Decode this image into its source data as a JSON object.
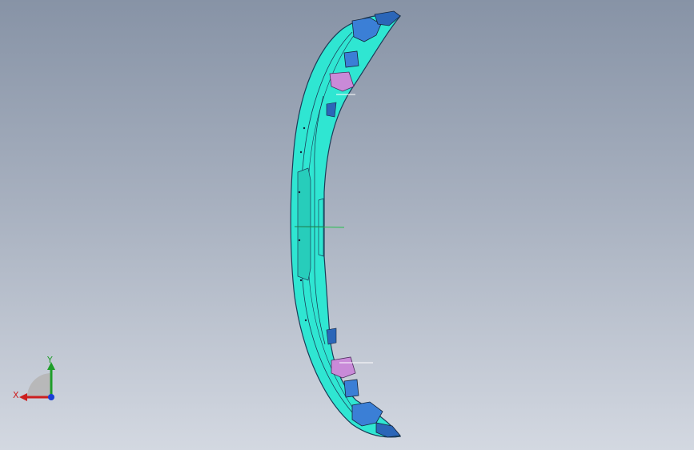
{
  "viewport": {
    "background_top": "#8793a6",
    "background_bottom": "#d3d8e1"
  },
  "model": {
    "icon": "bumper-part-icon",
    "body_color": "#2fe6d2",
    "edge_color": "#1b3b57",
    "bracket_color": "#3b7fd6",
    "clip_color": "#c98ad8",
    "origin_axis_color": "#22c04a"
  },
  "triad": {
    "x_label": "X",
    "y_label": "Y",
    "x_color": "#cc1f1f",
    "y_color": "#1f9e2a",
    "z_color": "#1a3fd6"
  }
}
